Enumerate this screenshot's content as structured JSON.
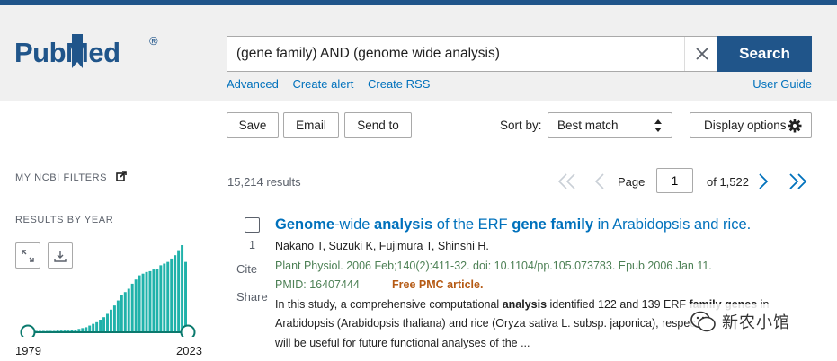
{
  "brand": {
    "logo_text": "PubMed",
    "logo_mark": "®",
    "colors": {
      "primary": "#20558a",
      "link": "#0071bc",
      "journal_green": "#4d8055",
      "free_orange": "#b55a14",
      "chart_teal": "#20b2aa"
    }
  },
  "search": {
    "query": "(gene family) AND (genome wide analysis)",
    "button_label": "Search",
    "clear_icon": "close-icon"
  },
  "sublinks": [
    "Advanced",
    "Create alert",
    "Create RSS"
  ],
  "user_guide": "User Guide",
  "toolbar": {
    "save": "Save",
    "email": "Email",
    "send_to": "Send to",
    "sort_label": "Sort by:",
    "sort_value": "Best match",
    "display_options": "Display options"
  },
  "sidebar": {
    "filters_heading": "MY NCBI FILTERS",
    "results_by_year": "RESULTS BY YEAR",
    "year_start": "1979",
    "year_end": "2023"
  },
  "chart_data": {
    "type": "bar",
    "xlim": [
      1979,
      2023
    ],
    "values": [
      1,
      1,
      1,
      1,
      1,
      1,
      1,
      1,
      2,
      2,
      2,
      2,
      3,
      3,
      4,
      5,
      6,
      8,
      10,
      12,
      15,
      18,
      22,
      27,
      32,
      38,
      44,
      48,
      52,
      58,
      63,
      68,
      70,
      72,
      73,
      75,
      76,
      80,
      82,
      84,
      88,
      92,
      98,
      104,
      84
    ],
    "color": "#20b2aa"
  },
  "results": {
    "count_text": "15,214 results",
    "page_label": "Page",
    "page_value": "1",
    "page_of": "of 1,522"
  },
  "article": {
    "number": "1",
    "cite": "Cite",
    "share": "Share",
    "title_parts": [
      {
        "text": "Genome",
        "bold": true
      },
      {
        "text": "-wide ",
        "bold": false
      },
      {
        "text": "analysis",
        "bold": true
      },
      {
        "text": " of the ERF ",
        "bold": false
      },
      {
        "text": "gene family",
        "bold": true
      },
      {
        "text": " in Arabidopsis and rice.",
        "bold": false
      }
    ],
    "authors": "Nakano T, Suzuki K, Fujimura T, Shinshi H.",
    "citation": "Plant Physiol. 2006 Feb;140(2):411-32. doi: 10.1104/pp.105.073783. Epub 2006 Jan 11.",
    "pmid": "PMID: 16407444",
    "free_label": "Free PMC article.",
    "snippet_lines": [
      [
        {
          "text": "In this study, a comprehensive computational ",
          "bold": false
        },
        {
          "text": "analysis",
          "bold": true
        },
        {
          "text": " identified 122 and 139 ERF ",
          "bold": false
        },
        {
          "text": "family genes",
          "bold": true
        },
        {
          "text": " in",
          "bold": false
        }
      ],
      [
        {
          "text": "Arabidopsis (Arabidopsis thaliana) and rice (Oryza sativa L. subsp. japonica), respec",
          "bold": false
        }
      ],
      [
        {
          "text": "will be useful for future functional analyses of the ...",
          "bold": false
        }
      ]
    ]
  },
  "watermark": {
    "text": "新农小馆"
  }
}
